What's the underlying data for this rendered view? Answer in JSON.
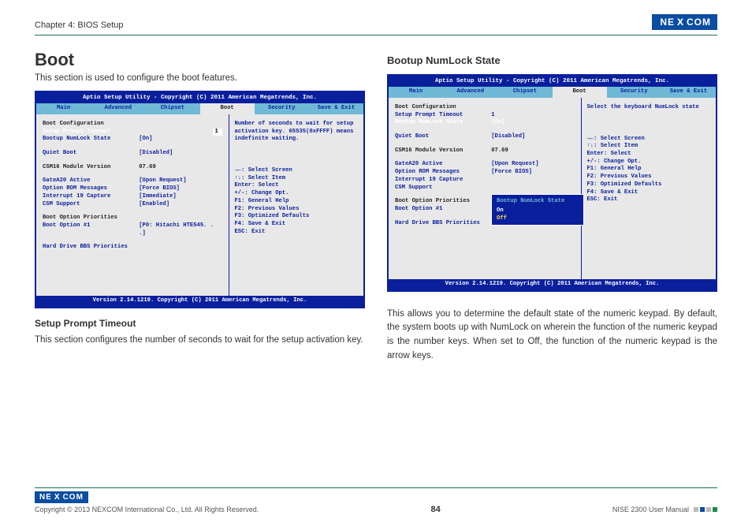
{
  "chapter": "Chapter 4: BIOS Setup",
  "brand": "NEXCOM",
  "left": {
    "h1": "Boot",
    "lead": "This section is used to configure the boot features.",
    "sub_h": "Setup Prompt Timeout",
    "sub_p": "This section configures the number of seconds to wait for the setup activation key."
  },
  "right": {
    "h2": "Bootup NumLock State",
    "p": "This allows you to determine the default state of the numeric keypad. By default, the system boots up with NumLock on wherein the function of the numeric keypad is the number keys. When set to Off, the function of the numeric keypad is the arrow keys."
  },
  "bios_common": {
    "title": "Aptio Setup Utility - Copyright (C) 2011 American Megatrends, Inc.",
    "footer": "Version 2.14.1219. Copyright (C) 2011 American Megatrends, Inc.",
    "tabs": [
      "Main",
      "Advanced",
      "Chipset",
      "Boot",
      "Security",
      "Save & Exit"
    ],
    "active_tab": "Boot",
    "helpkeys": [
      "→←: Select Screen",
      "↑↓: Select Item",
      "Enter: Select",
      "+/-: Change Opt.",
      "F1: General Help",
      "F2: Previous Values",
      "F3: Optimized Defaults",
      "F4: Save & Exit",
      "ESC: Exit"
    ],
    "groups": {
      "config_head": "Boot Configuration",
      "setup_prompt": {
        "label": "Setup Prompt Timeout",
        "value": "1"
      },
      "numlock": {
        "label": "Bootup NumLock State",
        "value": "[On]"
      },
      "quiet": {
        "label": "Quiet Boot",
        "value": "[Disabled]"
      },
      "csm16": {
        "label": "CSM16 Module Version",
        "value": "07.69"
      },
      "gatea20": {
        "label": "GateA20 Active",
        "value": "[Upon Request]"
      },
      "orom": {
        "label": "Option ROM Messages",
        "value": "[Force BIOS]"
      },
      "int19": {
        "label": "Interrupt 19 Capture",
        "value": "[Immediate]"
      },
      "csm": {
        "label": "CSM Support",
        "value": "[Enabled]"
      },
      "prio_head": "Boot Option Priorities",
      "opt1": {
        "label": "Boot Option #1",
        "value": "[P0: Hitachi HTE545. . .]"
      },
      "hdbbs": {
        "label": "Hard Drive BBS Priorities",
        "value": ""
      }
    }
  },
  "bios_left_help": "Number of seconds to wait for setup activation key. 65535(0xFFFF) means indefinite waiting.",
  "bios_right_help": "Select the keyboard NumLock state",
  "popup": {
    "title": "Bootup NumLock State",
    "on": "On",
    "off": "Off"
  },
  "footer": {
    "copyright": "Copyright © 2013 NEXCOM International Co., Ltd. All Rights Reserved.",
    "page": "84",
    "manual": "NISE 2300 User Manual"
  }
}
